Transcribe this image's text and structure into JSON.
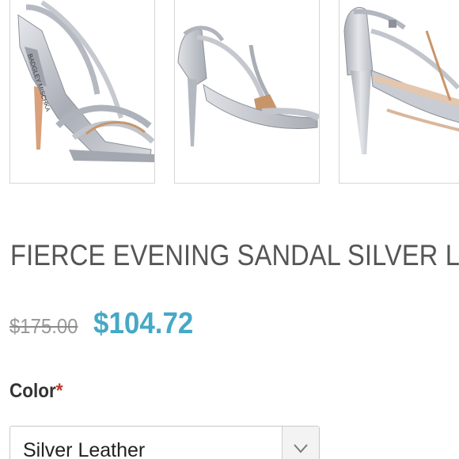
{
  "gallery": {
    "images": [
      {
        "name": "sandal-side-view",
        "brand_mark": "BADGLEY MISCHKA"
      },
      {
        "name": "sandal-angle-view"
      },
      {
        "name": "sandal-heel-view"
      }
    ]
  },
  "product": {
    "title": "FIERCE EVENING SANDAL SILVER LEATHER",
    "price": {
      "original": "$175.00",
      "sale": "$104.72"
    },
    "color": {
      "label": "Color",
      "required_mark": "*",
      "selected": "Silver Leather"
    }
  },
  "colors": {
    "sale_price": "#45a9c6",
    "required": "#c0392b",
    "silver": "#b8bcc4",
    "tan_lining": "#c8956b"
  }
}
